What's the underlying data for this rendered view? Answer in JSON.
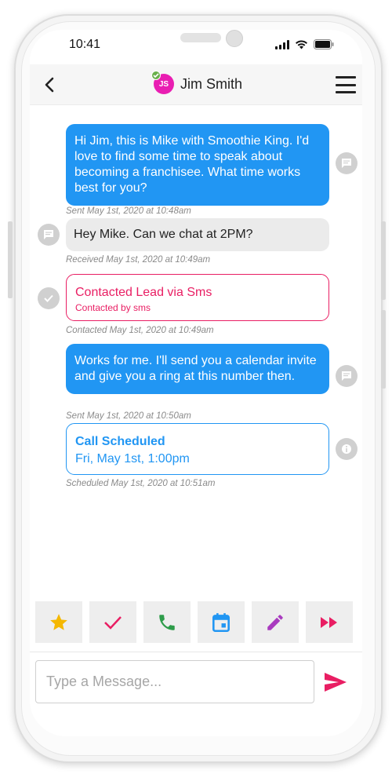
{
  "status_bar": {
    "time": "10:41"
  },
  "header": {
    "contact_initials": "JS",
    "contact_name": "Jim Smith",
    "avatar_color": "#e91eb2",
    "online_badge_color": "#6ab04c"
  },
  "messages": [
    {
      "type": "outgoing",
      "text": "Hi Jim, this is Mike with Smoothie King. I'd love to find some time to speak about becoming a franchisee. What time works best for you?",
      "meta": "Sent May 1st, 2020 at 10:48am",
      "icon": "message-icon"
    },
    {
      "type": "incoming",
      "text": "Hey Mike. Can we chat at 2PM?",
      "meta": "Received May 1st, 2020 at 10:49am",
      "icon": "message-icon"
    },
    {
      "type": "event",
      "title": "Contacted Lead via Sms",
      "subtitle": "Contacted by sms",
      "meta": "Contacted May 1st, 2020 at 10:49am",
      "icon": "check-icon"
    },
    {
      "type": "outgoing",
      "text": "Works for me. I'll send you a calendar invite and give you a ring at this number then.",
      "meta": "Sent May 1st, 2020 at 10:50am",
      "icon": "message-icon"
    },
    {
      "type": "scheduled",
      "title": "Call Scheduled",
      "subtitle": "Fri, May 1st, 1:00pm",
      "meta": "Scheduled May 1st, 2020 at 10:51am",
      "icon": "info-icon"
    }
  ],
  "actions": [
    {
      "name": "star-icon",
      "color": "#f5b800"
    },
    {
      "name": "check-icon",
      "color": "#e91e63"
    },
    {
      "name": "phone-icon",
      "color": "#2e9c4a"
    },
    {
      "name": "calendar-icon",
      "color": "#2196f3"
    },
    {
      "name": "pencil-icon",
      "color": "#a93bbf"
    },
    {
      "name": "fast-forward-icon",
      "color": "#e91e63"
    }
  ],
  "compose": {
    "placeholder": "Type a Message...",
    "value": "",
    "send_color": "#e91e63"
  },
  "colors": {
    "outgoing_bubble": "#2196f3",
    "incoming_bubble": "#ebebeb",
    "event_accent": "#e91e63",
    "scheduled_accent": "#2196f3"
  }
}
